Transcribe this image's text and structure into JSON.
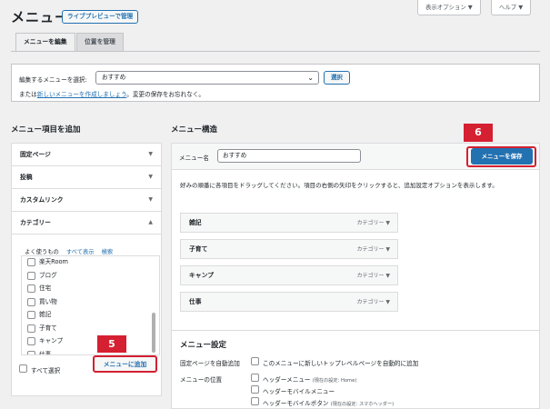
{
  "header": {
    "title": "メニュー",
    "live_preview_label": "ライブプレビューで管理",
    "screen_options_label": "表示オプション ▼",
    "help_label": "ヘルプ ▼"
  },
  "tabs": [
    {
      "label": "メニューを編集"
    },
    {
      "label": "位置を管理"
    }
  ],
  "select_menu": {
    "label": "編集するメニューを選択:",
    "selected": "おすすめ",
    "select_button": "選択",
    "note_prefix": "または",
    "note_link": "新しいメニューを作成しましょう",
    "note_suffix": "。変更の保存をお忘れなく。"
  },
  "add_items": {
    "heading": "メニュー項目を追加",
    "sections": [
      {
        "label": "固定ページ",
        "arrow": "▼"
      },
      {
        "label": "投稿",
        "arrow": "▼"
      },
      {
        "label": "カスタムリンク",
        "arrow": "▼"
      },
      {
        "label": "カテゴリー",
        "arrow": "▲"
      }
    ],
    "subtabs": [
      "よく使うもの",
      "すべて表示",
      "検索"
    ],
    "categories": [
      "楽天Room",
      "ブログ",
      "住宅",
      "買い物",
      "雑記",
      "子育て",
      "キャンプ",
      "仕事"
    ],
    "select_all": "すべて選択",
    "add_button": "メニューに追加"
  },
  "structure": {
    "heading": "メニュー構造",
    "name_label": "メニュー名",
    "name_value": "おすすめ",
    "save_button": "メニューを保存",
    "instructions": "好みの順番に各項目をドラッグしてください。項目の右側の矢印をクリックすると、追加設定オプションを表示します。",
    "items": [
      {
        "title": "雑記",
        "type": "カテゴリー ▼"
      },
      {
        "title": "子育て",
        "type": "カテゴリー ▼"
      },
      {
        "title": "キャンプ",
        "type": "カテゴリー ▼"
      },
      {
        "title": "仕事",
        "type": "カテゴリー ▼"
      }
    ]
  },
  "settings": {
    "heading": "メニュー設定",
    "auto_add_label": "固定ページを自動追加",
    "auto_add_option": "このメニューに新しいトップレベルページを自動的に追加",
    "location_label": "メニューの位置",
    "locations": [
      {
        "label": "ヘッダーメニュー",
        "note": "(現在の設定: Home)"
      },
      {
        "label": "ヘッダーモバイルメニュー",
        "note": ""
      },
      {
        "label": "ヘッダーモバイルボタン",
        "note": "(現在の設定: スマホヘッダー)"
      }
    ]
  },
  "callouts": {
    "save": "6",
    "add": "5"
  },
  "colors": {
    "accent": "#2271b1",
    "callout_red": "#d42031",
    "background": "#f0f0f1"
  }
}
